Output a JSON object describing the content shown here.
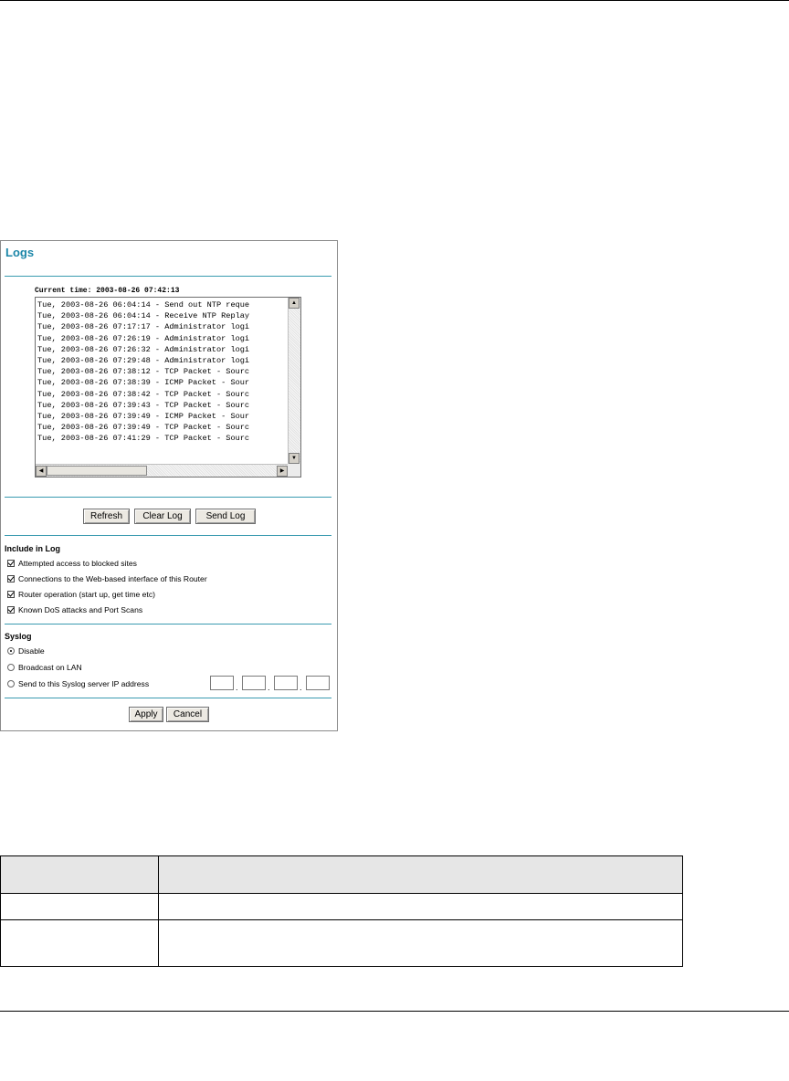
{
  "window": {
    "title": "Logs",
    "current_time_label": "Current time: 2003-08-26 07:42:13",
    "log_lines": [
      "Tue, 2003-08-26 06:04:14 - Send out NTP reque",
      "Tue, 2003-08-26 06:04:14 - Receive NTP Replay",
      "Tue, 2003-08-26 07:17:17 - Administrator logi",
      "Tue, 2003-08-26 07:26:19 - Administrator logi",
      "Tue, 2003-08-26 07:26:32 - Administrator logi",
      "Tue, 2003-08-26 07:29:48 - Administrator logi",
      "Tue, 2003-08-26 07:38:12 - TCP Packet - Sourc",
      "Tue, 2003-08-26 07:38:39 - ICMP Packet - Sour",
      "Tue, 2003-08-26 07:38:42 - TCP Packet - Sourc",
      "Tue, 2003-08-26 07:39:43 - TCP Packet - Sourc",
      "Tue, 2003-08-26 07:39:49 - ICMP Packet - Sour",
      "Tue, 2003-08-26 07:39:49 - TCP Packet - Sourc",
      "Tue, 2003-08-26 07:41:29 - TCP Packet - Sourc"
    ],
    "buttons": {
      "refresh": "Refresh",
      "clear_log": "Clear Log",
      "send_log": "Send Log",
      "apply": "Apply",
      "cancel": "Cancel"
    },
    "include_in_log": {
      "heading": "Include in Log",
      "options": [
        {
          "label": "Attempted access to blocked sites",
          "checked": true
        },
        {
          "label": "Connections to the Web-based interface of this Router",
          "checked": true
        },
        {
          "label": "Router operation (start up, get time etc)",
          "checked": true
        },
        {
          "label": "Known DoS attacks and Port Scans",
          "checked": true
        }
      ]
    },
    "syslog": {
      "heading": "Syslog",
      "options": [
        {
          "label": "Disable",
          "selected": true
        },
        {
          "label": "Broadcast on LAN",
          "selected": false
        },
        {
          "label": "Send to this Syslog server IP address",
          "selected": false
        }
      ],
      "ip_octets": [
        "",
        "",
        "",
        ""
      ]
    }
  },
  "table": {
    "header": [
      "",
      ""
    ],
    "rows": [
      [
        "",
        ""
      ],
      [
        "",
        ""
      ]
    ]
  }
}
